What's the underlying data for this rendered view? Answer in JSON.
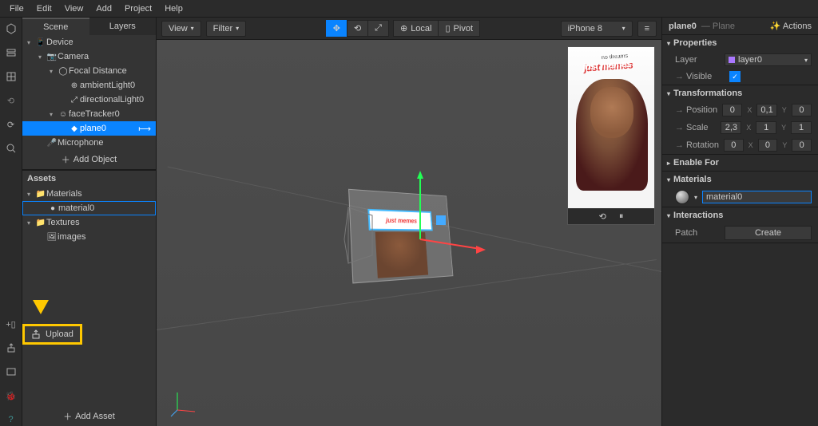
{
  "menu": {
    "items": [
      "File",
      "Edit",
      "View",
      "Add",
      "Project",
      "Help"
    ]
  },
  "rail_top": [
    "cube-icon",
    "layers-icon",
    "grid-icon",
    "camera-icon",
    "refresh-icon",
    "search-icon"
  ],
  "rail_bottom": [
    "device-icon",
    "upload-icon",
    "library-icon",
    "bug-icon",
    "help-icon"
  ],
  "sidebar": {
    "tabs": [
      "Scene",
      "Layers"
    ],
    "active_tab": 0,
    "tree": [
      {
        "depth": 0,
        "caret": "▾",
        "icon": "📱",
        "label": "Device"
      },
      {
        "depth": 1,
        "caret": "▾",
        "icon": "📷",
        "label": "Camera"
      },
      {
        "depth": 2,
        "caret": "▾",
        "icon": "◯",
        "label": "Focal Distance"
      },
      {
        "depth": 3,
        "caret": "",
        "icon": "⊕",
        "label": "ambientLight0"
      },
      {
        "depth": 3,
        "caret": "",
        "icon": "⤢",
        "label": "directionalLight0"
      },
      {
        "depth": 2,
        "caret": "▾",
        "icon": "☺",
        "label": "faceTracker0"
      },
      {
        "depth": 3,
        "caret": "",
        "icon": "◆",
        "label": "plane0",
        "selected": true,
        "suffix": "⟼"
      },
      {
        "depth": 1,
        "caret": "",
        "icon": "🎤",
        "label": "Microphone"
      }
    ],
    "add_object": "Add Object",
    "assets_title": "Assets",
    "assets": [
      {
        "depth": 0,
        "caret": "▾",
        "icon": "📁",
        "label": "Materials"
      },
      {
        "depth": 1,
        "caret": "",
        "icon": "●",
        "label": "material0",
        "boxed": true
      },
      {
        "depth": 0,
        "caret": "▾",
        "icon": "📁",
        "label": "Textures"
      },
      {
        "depth": 1,
        "caret": "",
        "icon": "🖼",
        "label": "images"
      }
    ],
    "upload_label": "Upload",
    "add_asset": "Add Asset"
  },
  "viewport": {
    "view_btn": "View",
    "filter_btn": "Filter",
    "local_btn": "Local",
    "pivot_btn": "Pivot",
    "device": "iPhone 8"
  },
  "inspector": {
    "object_name": "plane0",
    "object_type": "— Plane",
    "actions": "Actions",
    "sections": {
      "properties": "Properties",
      "layer_label": "Layer",
      "layer_value": "layer0",
      "visible_label": "Visible",
      "transformations": "Transformations",
      "position": {
        "label": "Position",
        "x": "0",
        "y": "0,1",
        "z": "0"
      },
      "scale": {
        "label": "Scale",
        "x": "2,3",
        "y": "1",
        "z": "1"
      },
      "rotation": {
        "label": "Rotation",
        "x": "0",
        "y": "0",
        "z": "0"
      },
      "enable_for": "Enable For",
      "materials": "Materials",
      "material_name": "material0",
      "interactions": "Interactions",
      "patch_label": "Patch",
      "create_label": "Create"
    }
  }
}
